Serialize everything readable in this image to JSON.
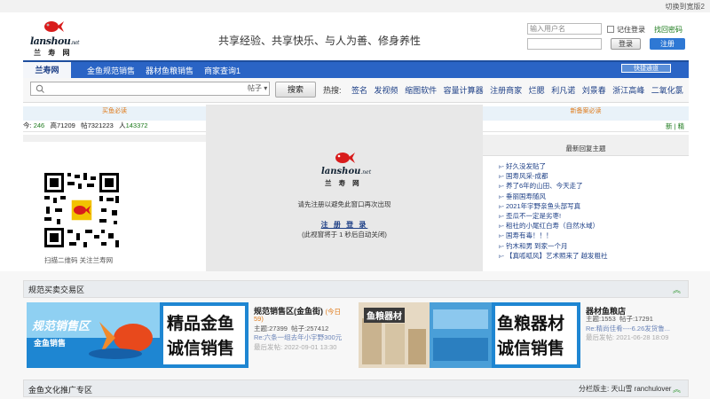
{
  "topbar": {
    "switch_width": "切换到宽版2"
  },
  "header": {
    "logo_text": "lanshou",
    "logo_suffix": ".net",
    "logo_cn": "兰 寿 网",
    "slogan": "共享经验、共享快乐、与人为善、修身养性"
  },
  "login": {
    "username_placeholder": "输入用户名",
    "remember_label": "记住登录",
    "find_password": "找回密码",
    "login_button": "登录",
    "register_button": "注册"
  },
  "nav": {
    "home": "兰寿网",
    "items": [
      "金鱼规范销售",
      "器材鱼粮销售",
      "商家查询1"
    ],
    "quick_button": "快捷通道"
  },
  "search": {
    "type": "帖子",
    "button": "搜索",
    "hot_label": "热搜:",
    "hot_terms": [
      "签名",
      "发视频",
      "缩图软件",
      "容量计算器",
      "注册商家",
      "烂腮",
      "利凡诺",
      "刘景春",
      "浙江高峰",
      "二氧化氯"
    ]
  },
  "bands": {
    "left": "买鱼必读",
    "right": "新备案必读"
  },
  "stats": {
    "today_label": "今:",
    "today": "246",
    "topics_label": "高",
    "topics": "71209",
    "posts_label": "帖",
    "posts": "7321223",
    "members_label": "人",
    "members": "143372",
    "right_text": "新 | 精"
  },
  "qr": {
    "caption": "扫描二维码 关注兰寿网"
  },
  "replies": {
    "header": "最新回复主题",
    "items": [
      "好久没发贴了",
      "国寿风采-成都",
      "养了6年的山田、今天走了",
      "垂丽国寿随风",
      "2021年宇野亲鱼头部写真",
      "歪瓜不一定是劣枣!",
      "租社的小尾红白寿（自然水域）",
      "国寿有毒！！！",
      "钓木和男 到家一个月",
      "【真呱呱风】艺术照来了 越发粗社"
    ]
  },
  "modal": {
    "message": "请先注册以避免此窗口再次出现",
    "link": "注 册 登 录",
    "note": "(此视窗将于 1 秒后自动关闭)"
  },
  "trade_section": {
    "title": "规范买卖交易区",
    "forum1": {
      "banner_small": "规范销售区",
      "banner_sub": "金鱼销售",
      "banner_big1": "精品金鱼",
      "banner_big2": "诚信销售",
      "name": "规范销售区(金鱼街)",
      "today": "(今日",
      "today_count": "59)",
      "topics_label": "主题:",
      "topics": "27399",
      "posts_label": "帖子:",
      "posts": "257412",
      "latest": "Re:六条一组去年小宇野300元",
      "last_post": "最后发帖: 2022-09-01 13:30"
    },
    "forum2": {
      "banner_tag": "鱼粮器材",
      "banner_big1": "鱼粮器材",
      "banner_big2": "诚信销售",
      "name": "器材鱼粮店",
      "topics_label": "主题:",
      "topics": "1553",
      "posts_label": "帖子:",
      "posts": "17291",
      "latest": "Re:精尚佳肴----6.26发货鲁...",
      "last_post": "最后发帖: 2021-06-28 18:09"
    }
  },
  "culture_section": {
    "title": "金鱼文化推广专区",
    "moderators": "分栏版主: 天山雪 ranchulover"
  },
  "colors": {
    "nav_blue": "#2a64c5",
    "register_blue": "#2e78d4",
    "link_blue": "#1d3f86",
    "accent_orange": "#e07b1b",
    "stat_green": "#1d7a1d"
  }
}
